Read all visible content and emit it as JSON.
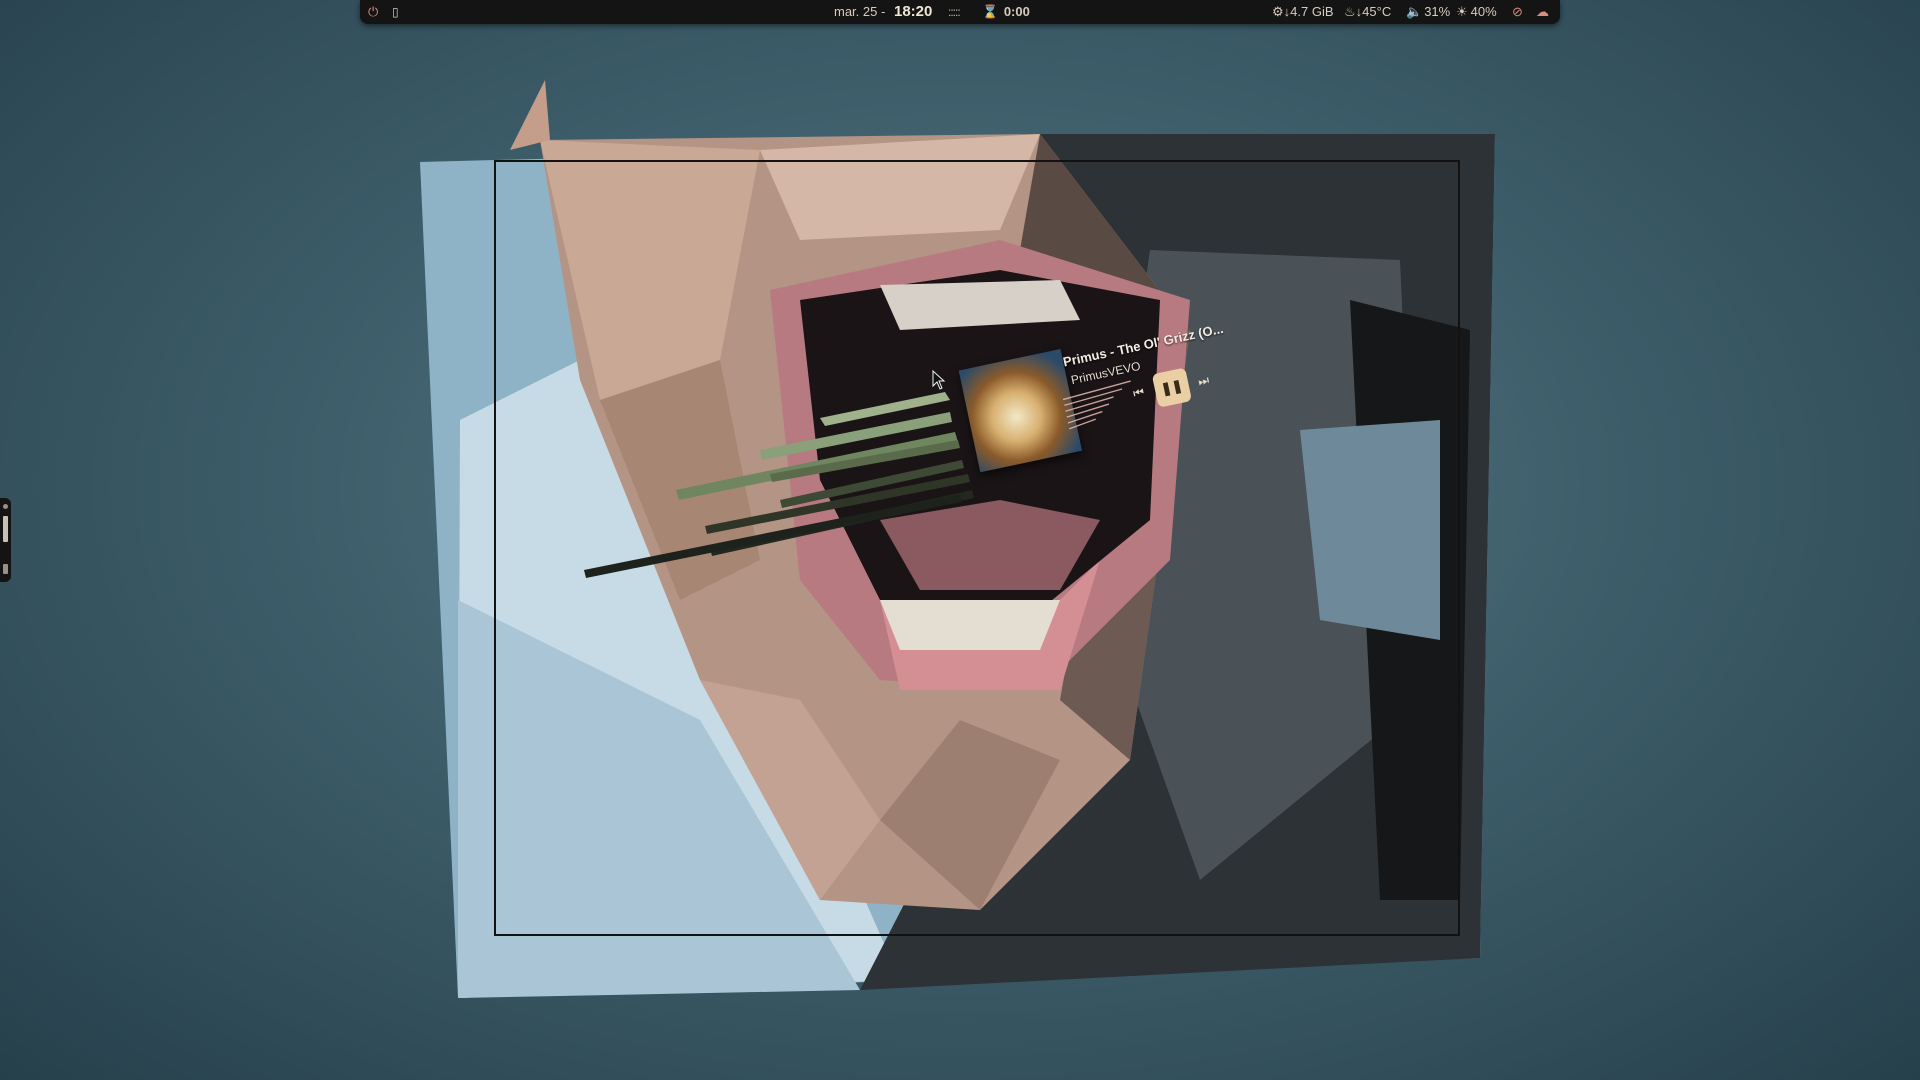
{
  "topbar": {
    "power_icon": "power-icon",
    "clipboard_icon": "clipboard-icon",
    "date": "mar. 25 -",
    "time": "18:20",
    "workspaces": ":::::",
    "timer_icon": "hourglass-icon",
    "timer": "0:00",
    "memory": "4.7 GiB",
    "temperature": "45°C",
    "volume": "31%",
    "brightness": "40%"
  },
  "media": {
    "title": "Primus - The Ol' Grizz (O...",
    "artist": "PrimusVEVO",
    "prev_icon": "skip-previous-icon",
    "play_icon": "pause-icon",
    "next_icon": "skip-next-icon"
  },
  "colors": {
    "bar_bg": "#141414",
    "accent": "#d98d84",
    "play_button": "#e9cfa3",
    "desktop": "#3f5f6c"
  }
}
